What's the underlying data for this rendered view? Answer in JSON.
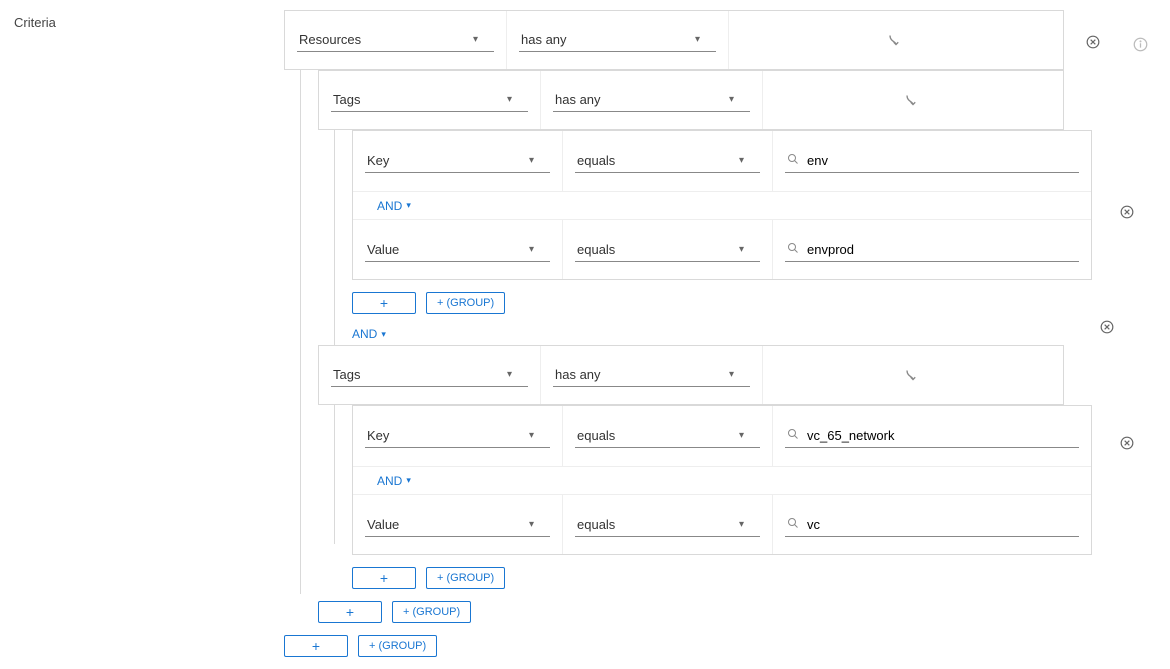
{
  "label": "Criteria",
  "operators": {
    "and": "AND"
  },
  "buttons": {
    "plus": "+",
    "plus_group": "+ (GROUP)"
  },
  "root": {
    "field": "Resources",
    "op": "has any",
    "children": [
      {
        "field": "Tags",
        "op": "has any",
        "kv": [
          {
            "key_field": "Key",
            "key_op": "equals",
            "key_val": "env",
            "val_field": "Value",
            "val_op": "equals",
            "val_val": "envprod"
          }
        ]
      },
      {
        "field": "Tags",
        "op": "has any",
        "kv": [
          {
            "key_field": "Key",
            "key_op": "equals",
            "key_val": "vc_65_network",
            "val_field": "Value",
            "val_op": "equals",
            "val_val": "vc"
          }
        ]
      }
    ]
  }
}
